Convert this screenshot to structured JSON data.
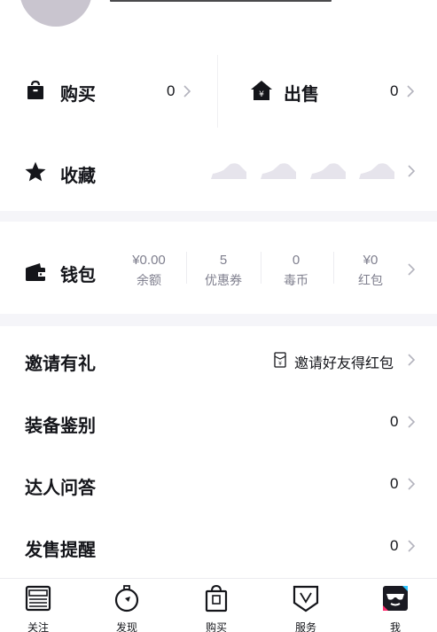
{
  "orders": {
    "buy_label": "购买",
    "buy_count": "0",
    "sell_label": "出售",
    "sell_count": "0"
  },
  "favorites": {
    "label": "收藏"
  },
  "wallet": {
    "label": "钱包",
    "items": [
      {
        "value": "¥0.00",
        "label": "余额"
      },
      {
        "value": "5",
        "label": "优惠券"
      },
      {
        "value": "0",
        "label": "毒币"
      },
      {
        "value": "¥0",
        "label": "红包"
      }
    ]
  },
  "list": [
    {
      "title": "邀请有礼",
      "right": "邀请好友得红包"
    },
    {
      "title": "装备鉴别",
      "right": "0"
    },
    {
      "title": "达人问答",
      "right": "0"
    },
    {
      "title": "发售提醒",
      "right": "0"
    }
  ],
  "tabs": [
    {
      "label": "关注",
      "icon": "news-icon"
    },
    {
      "label": "发现",
      "icon": "compass-icon"
    },
    {
      "label": "购买",
      "icon": "shopping-bag-icon"
    },
    {
      "label": "服务",
      "icon": "shield-icon"
    },
    {
      "label": "我",
      "icon": "profile-icon"
    }
  ]
}
